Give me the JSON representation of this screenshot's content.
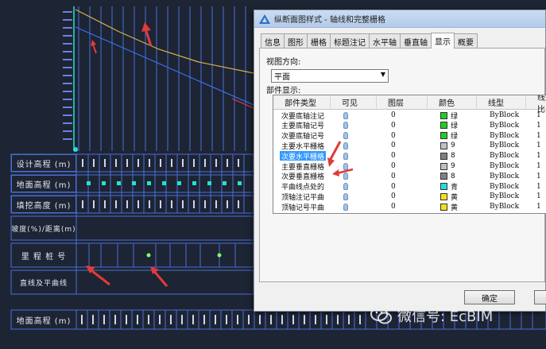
{
  "cad": {
    "row_labels": [
      "设计高程 (m)",
      "地面高程 (m)",
      "填挖高度 (m)",
      "坡度(%)/距离(m)",
      "里 程 桩 号",
      "直线及平曲线",
      "地面高程 (m)"
    ],
    "colors": {
      "background": "#1d2433",
      "grid_line": "#4a6fd8",
      "profile_line": "#d8b44a",
      "ground_line": "#3a6ff0",
      "arrow": "#e23a3a",
      "marker": "#22e3d0"
    }
  },
  "dialog": {
    "title": "纵断面图样式 - 轴线和完整栅格",
    "tabs": [
      "信息",
      "图形",
      "栅格",
      "标题注记",
      "水平轴",
      "垂直轴",
      "显示",
      "概要"
    ],
    "active_tab": "显示",
    "view_direction_label": "视图方向:",
    "view_direction_value": "平面",
    "components_label": "部件显示:",
    "columns": [
      "部件类型",
      "可见",
      "图层",
      "颜色",
      "线型",
      "线型比"
    ],
    "rows": [
      {
        "type": "次要底轴注记",
        "layer": "0",
        "color": "绿",
        "swatch": "#22cc22",
        "linetype": "ByBlock",
        "lw": "1"
      },
      {
        "type": "主要底轴记号",
        "layer": "0",
        "color": "绿",
        "swatch": "#22cc22",
        "linetype": "ByBlock",
        "lw": "1"
      },
      {
        "type": "次要底轴记号",
        "layer": "0",
        "color": "绿",
        "swatch": "#22cc22",
        "linetype": "ByBlock",
        "lw": "1"
      },
      {
        "type": "主要水平栅格",
        "layer": "0",
        "color": "9",
        "swatch": "#c0c0c0",
        "linetype": "ByBlock",
        "lw": "1"
      },
      {
        "type": "次要水平栅格",
        "layer": "0",
        "color": "8",
        "swatch": "#808080",
        "linetype": "ByBlock",
        "lw": "1"
      },
      {
        "type": "主要垂直栅格",
        "layer": "0",
        "color": "9",
        "swatch": "#c0c0c0",
        "linetype": "ByBlock",
        "lw": "1"
      },
      {
        "type": "次要垂直栅格",
        "layer": "0",
        "color": "8",
        "swatch": "#808080",
        "linetype": "ByBlock",
        "lw": "1"
      },
      {
        "type": "平曲线点处的",
        "layer": "0",
        "color": "青",
        "swatch": "#22dddd",
        "linetype": "ByBlock",
        "lw": "1"
      },
      {
        "type": "顶轴注记平曲",
        "layer": "0",
        "color": "黄",
        "swatch": "#f2e21c",
        "linetype": "ByBlock",
        "lw": "1"
      },
      {
        "type": "顶轴记号平曲",
        "layer": "0",
        "color": "黄",
        "swatch": "#f2e21c",
        "linetype": "ByBlock",
        "lw": "1"
      }
    ],
    "selected_row": 4,
    "ok_label": "确定"
  },
  "watermark": {
    "text": "微信号: EcBIM"
  }
}
